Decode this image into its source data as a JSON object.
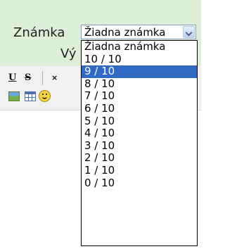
{
  "form": {
    "label": "Známka",
    "select": {
      "value": "Žiadna známka"
    },
    "behind_label": "Vý"
  },
  "toolbar": {
    "underline": "U",
    "strike": "S",
    "close": "×"
  },
  "dropdown": {
    "selected_index": 2,
    "options": [
      "Žiadna známka",
      "10 / 10",
      "9 / 10",
      "8 / 10",
      "7 / 10",
      "6 / 10",
      "5 / 10",
      "4 / 10",
      "3 / 10",
      "2 / 10",
      "1 / 10",
      "0 / 10"
    ]
  }
}
